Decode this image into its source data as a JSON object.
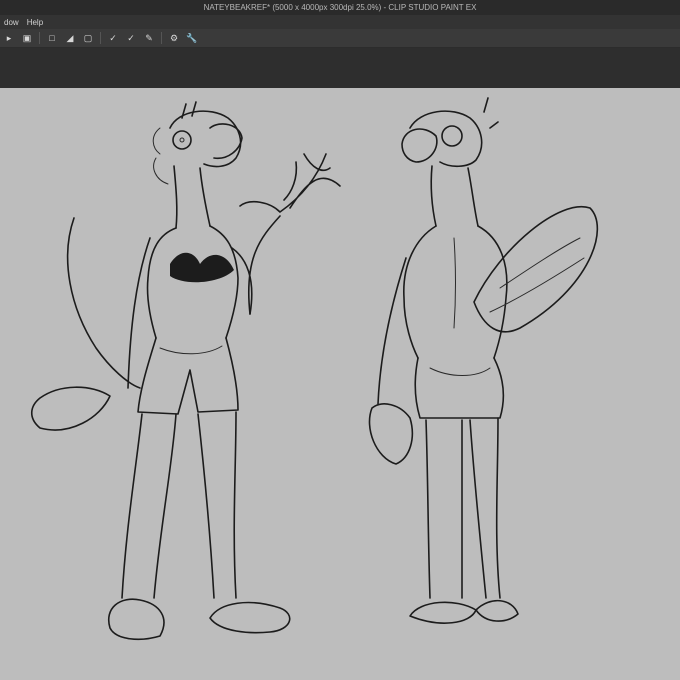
{
  "window": {
    "title": "NATEYBEAKREF* (5000 x 4000px 300dpi 25.0%)  - CLIP STUDIO PAINT EX"
  },
  "menu": {
    "items": [
      "dow",
      "Help"
    ]
  },
  "toolbar": {
    "icons": [
      "play-icon",
      "crop-icon",
      "transform-icon",
      "fill-icon",
      "select-icon",
      "pen-check-icon",
      "pen-check-2-icon",
      "pen-edit-icon",
      "settings-icon",
      "wrench-icon"
    ]
  },
  "canvas": {
    "background": "#bdbdbd",
    "subject": "character sketch"
  }
}
